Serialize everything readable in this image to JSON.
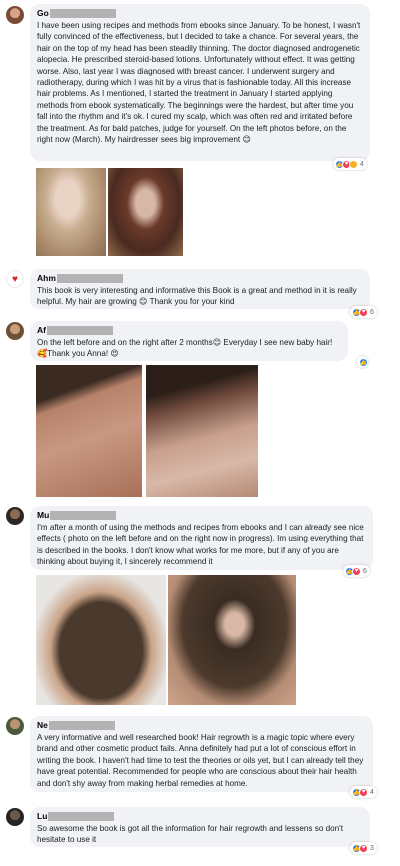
{
  "comments": [
    {
      "name": "Go",
      "text": "I have been using recipes and methods from ebooks since January. To be honest, I wasn't fully convinced of the effectiveness, but I decided to take a chance. For several years, the hair on the top of my head has been steadily thinning. The doctor diagnosed androgenetic alopecia. He prescribed steroid-based lotions. Unfortunately without effect. It was getting worse. Also, last year I was diagnosed with breast cancer. I underwent surgery and radiotherapy, during which I was hit by a virus that is fashionable today. All this increase hair problems. As I mentioned, I started the treatment in January I started applying methods from ebook systematically. The beginnings were the hardest, but after time you fall into the rhythm and it's ok. I cured my scalp, which was often red and irritated before the treatment. As for bald patches, judge for yourself. On the left photos before, on the right now (March). My hairdresser sees big improvement 😊",
      "reactions": "4"
    },
    {
      "name": "Ahm",
      "text": "This book is very interesting and informative this Book is a great and method in it is really helpful. My hair are growing 😊 Thank you for your kind",
      "reactions": "6"
    },
    {
      "name": "Af",
      "text": "On the left before and on the right after 2 months😊 Everyday I see new baby hair! 🥰Thank you Anna! 😍",
      "reactions": ""
    },
    {
      "name": "Mu",
      "text": "I'm after a month of using the methods and recipes from ebooks and I can already see nice effects ( photo on the left before and on the right now in progress). Im using everything that is described in the books. I don't know what works for me more, but if any of you are thinking about buying it, I sincerely recommend it",
      "reactions": "6"
    },
    {
      "name": "Ne",
      "text": "A very informative and well researched book! Hair regrowth is a magic topic where every brand and other cosmetic product fails. Anna definitely had put a lot of conscious effort in writing the book. I haven't had time to test the theories or oils yet, but I can already tell they have great potential. Recommended for people who are conscious about their hair health and don't shy away from making herbal remedies at home.",
      "reactions": "4"
    },
    {
      "name": "Lu",
      "text": "So awesome the book is got all the information for hair regrowth and lessens so don't hesitate to use it",
      "reactions": "3"
    }
  ],
  "colors": {
    "bubble": "#f0f2f5",
    "like": "#1877f2",
    "love": "#f33e58",
    "wow": "#f7b125"
  }
}
